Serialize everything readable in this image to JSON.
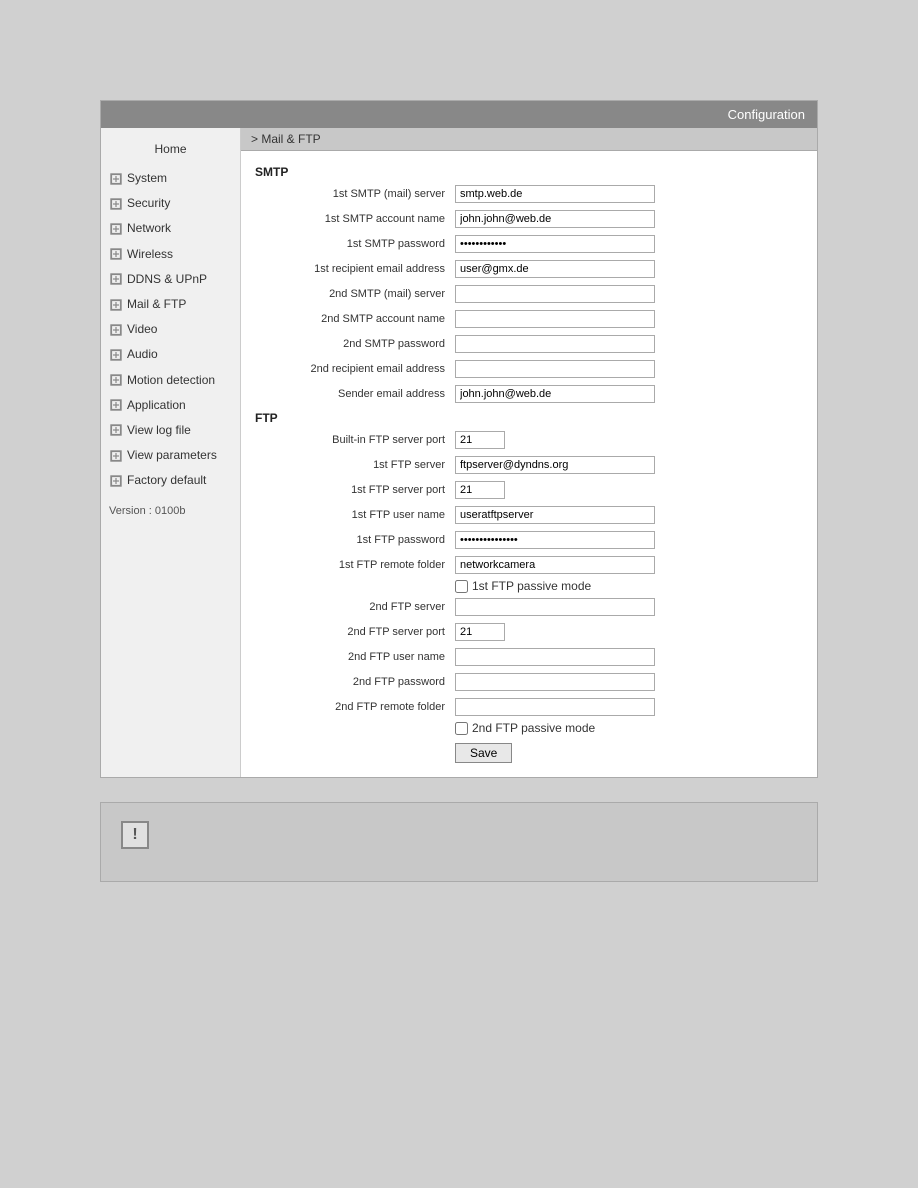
{
  "header": {
    "title": "Configuration"
  },
  "breadcrumb": "> Mail & FTP",
  "sidebar": {
    "home_label": "Home",
    "items": [
      {
        "label": "System",
        "id": "system"
      },
      {
        "label": "Security",
        "id": "security"
      },
      {
        "label": "Network",
        "id": "network"
      },
      {
        "label": "Wireless",
        "id": "wireless"
      },
      {
        "label": "DDNS & UPnP",
        "id": "ddns"
      },
      {
        "label": "Mail & FTP",
        "id": "mailftp"
      },
      {
        "label": "Video",
        "id": "video"
      },
      {
        "label": "Audio",
        "id": "audio"
      },
      {
        "label": "Motion detection",
        "id": "motion"
      },
      {
        "label": "Application",
        "id": "application"
      },
      {
        "label": "View log file",
        "id": "logfile"
      },
      {
        "label": "View parameters",
        "id": "parameters"
      },
      {
        "label": "Factory default",
        "id": "factory"
      }
    ],
    "version": "Version : 0100b"
  },
  "smtp": {
    "section_title": "SMTP",
    "fields": [
      {
        "label": "1st SMTP (mail) server",
        "value": "smtp.web.de",
        "type": "text",
        "id": "smtp1_server"
      },
      {
        "label": "1st SMTP account name",
        "value": "john.john@web.de",
        "type": "text",
        "id": "smtp1_account"
      },
      {
        "label": "1st SMTP password",
        "value": "••••••••••••",
        "type": "password",
        "id": "smtp1_password"
      },
      {
        "label": "1st recipient email address",
        "value": "user@gmx.de",
        "type": "text",
        "id": "smtp1_recipient"
      },
      {
        "label": "2nd SMTP (mail) server",
        "value": "",
        "type": "text",
        "id": "smtp2_server"
      },
      {
        "label": "2nd SMTP account name",
        "value": "",
        "type": "text",
        "id": "smtp2_account"
      },
      {
        "label": "2nd SMTP password",
        "value": "",
        "type": "password",
        "id": "smtp2_password"
      },
      {
        "label": "2nd recipient email address",
        "value": "",
        "type": "text",
        "id": "smtp2_recipient"
      },
      {
        "label": "Sender email address",
        "value": "john.john@web.de",
        "type": "text",
        "id": "smtp_sender"
      }
    ]
  },
  "ftp": {
    "section_title": "FTP",
    "fields": [
      {
        "label": "Built-in FTP server port",
        "value": "21",
        "type": "text",
        "small": true,
        "id": "ftp_builtin_port"
      },
      {
        "label": "1st FTP server",
        "value": "ftpserver@dyndns.org",
        "type": "text",
        "id": "ftp1_server"
      },
      {
        "label": "1st FTP server port",
        "value": "21",
        "type": "text",
        "small": true,
        "id": "ftp1_port"
      },
      {
        "label": "1st FTP user name",
        "value": "useratftpserver",
        "type": "text",
        "id": "ftp1_user"
      },
      {
        "label": "1st FTP password",
        "value": "••••••••••••••",
        "type": "password",
        "id": "ftp1_password"
      },
      {
        "label": "1st FTP remote folder",
        "value": "networkcamera",
        "type": "text",
        "id": "ftp1_folder"
      },
      {
        "label": "2nd FTP server",
        "value": "",
        "type": "text",
        "id": "ftp2_server"
      },
      {
        "label": "2nd FTP server port",
        "value": "21",
        "type": "text",
        "small": true,
        "id": "ftp2_port"
      },
      {
        "label": "2nd FTP user name",
        "value": "",
        "type": "text",
        "id": "ftp2_user"
      },
      {
        "label": "2nd FTP password",
        "value": "",
        "type": "password",
        "id": "ftp2_password"
      },
      {
        "label": "2nd FTP remote folder",
        "value": "",
        "type": "text",
        "id": "ftp2_folder"
      }
    ],
    "passive1_label": "1st FTP passive mode",
    "passive2_label": "2nd FTP passive mode"
  },
  "save_button": "Save"
}
